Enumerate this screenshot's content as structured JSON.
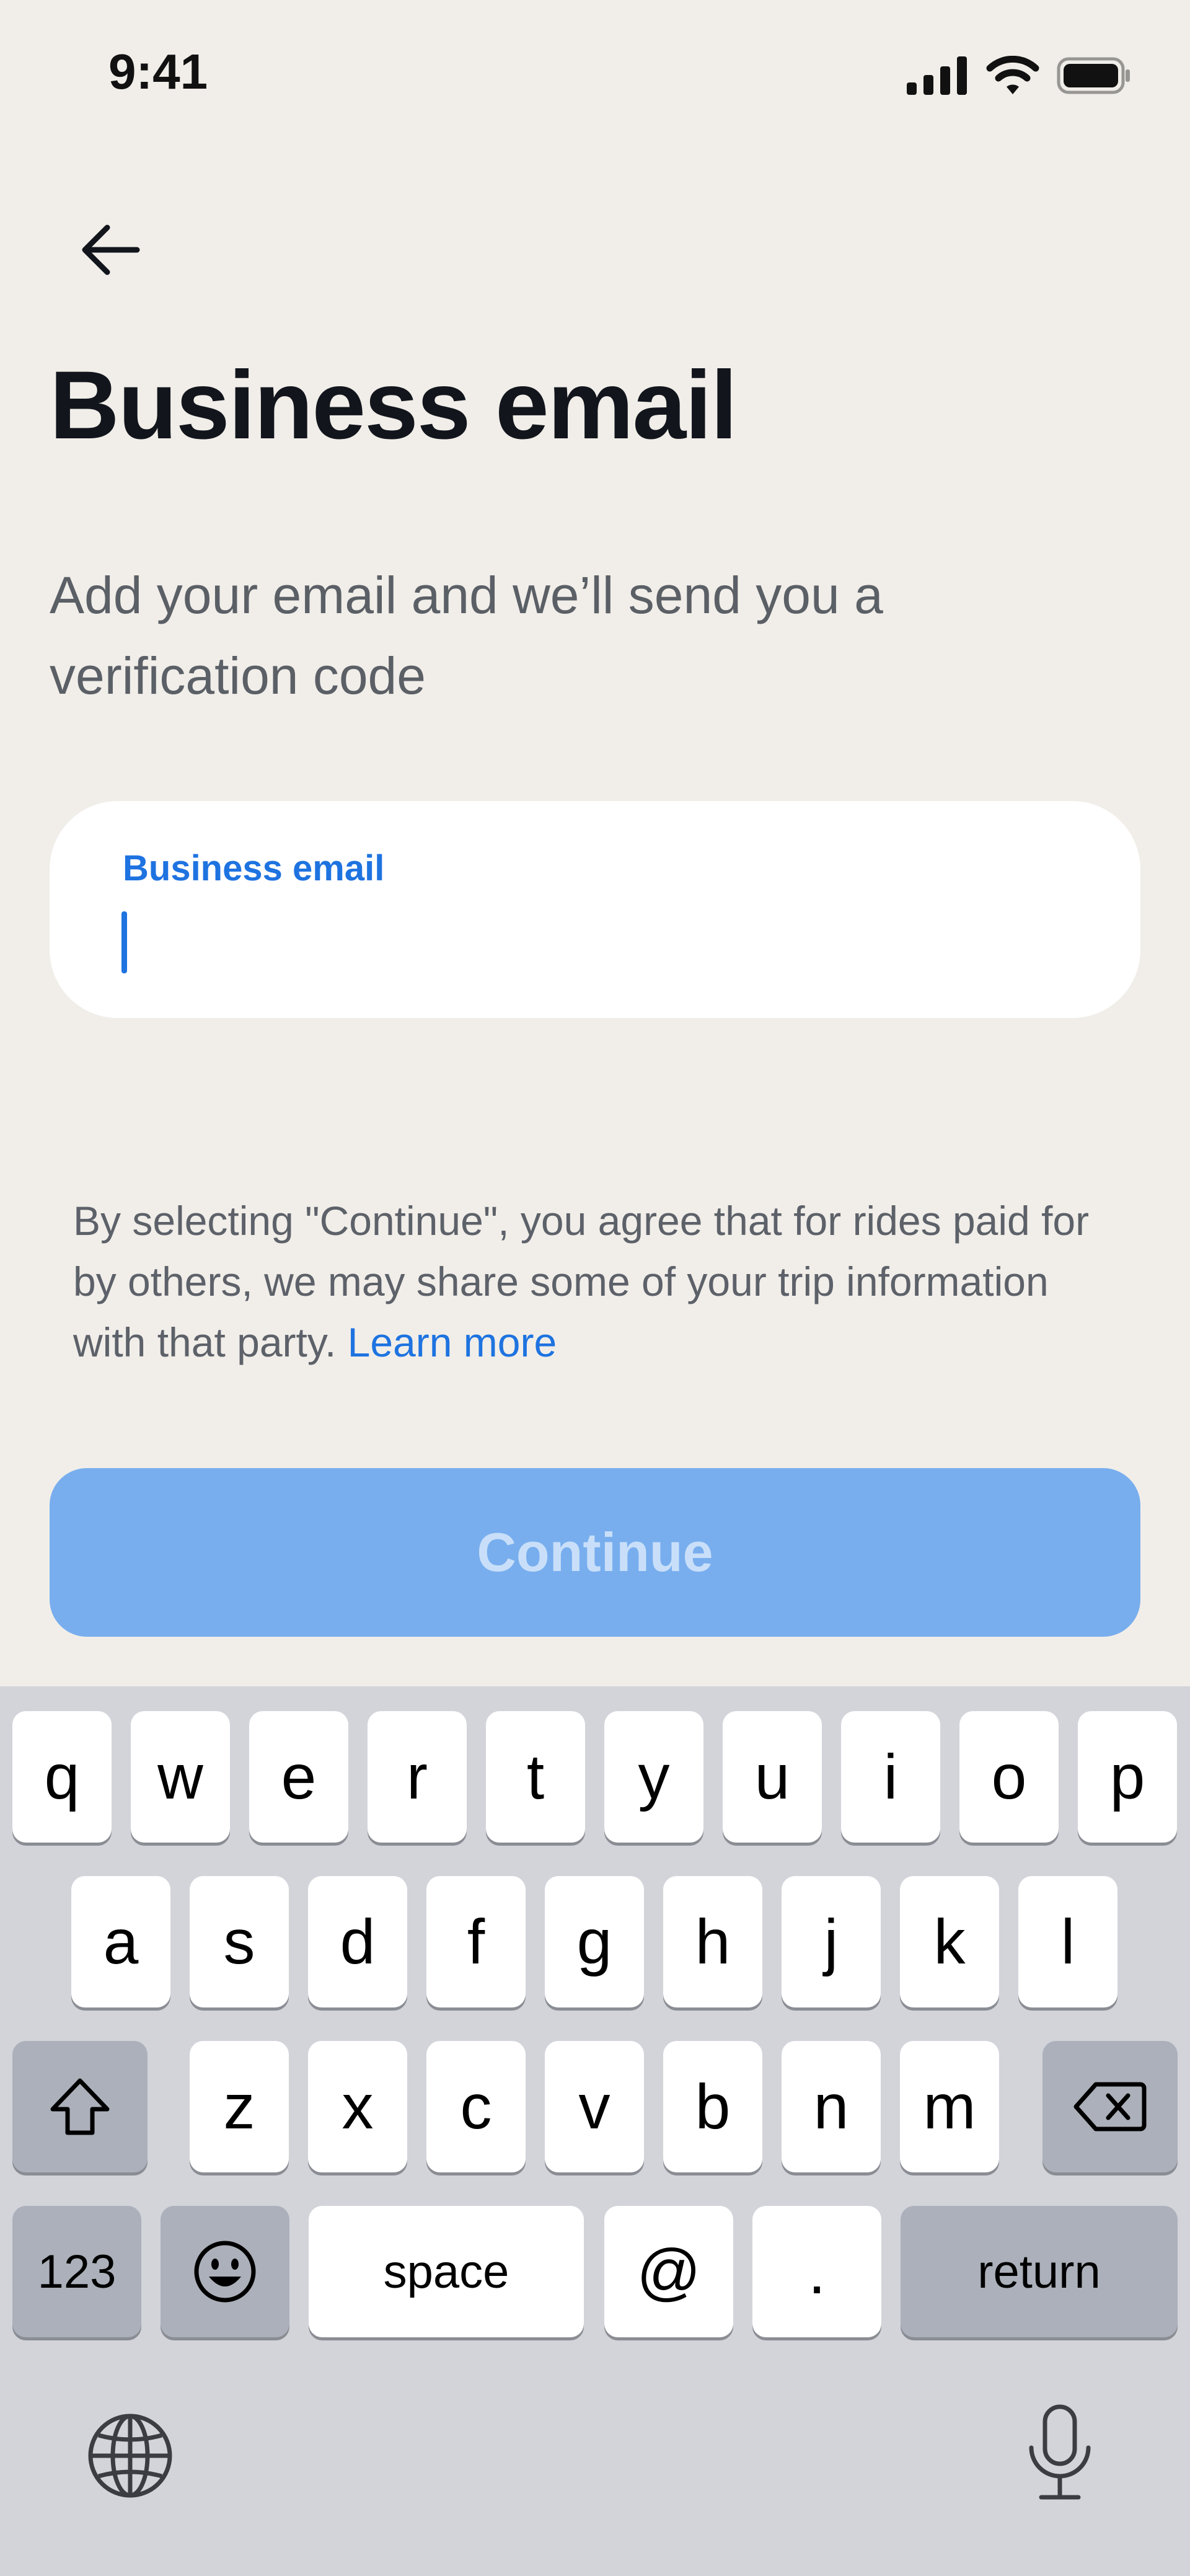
{
  "status_bar": {
    "time": "9:41",
    "icons": [
      "cellular-signal-icon",
      "wifi-icon",
      "battery-icon"
    ]
  },
  "nav": {
    "back_icon": "arrow-left-icon"
  },
  "title": "Business email",
  "subtitle": "Add your email and we’ll send you a verification code",
  "email_field": {
    "label": "Business email",
    "value": "",
    "placeholder": ""
  },
  "disclaimer": {
    "text": "By selecting \"Continue\", you agree that for rides paid for by others, we may share some of your trip information with that party.",
    "link": "Learn more"
  },
  "continue_button": {
    "label": "Continue",
    "enabled": false
  },
  "keyboard": {
    "row1": [
      "q",
      "w",
      "e",
      "r",
      "t",
      "y",
      "u",
      "i",
      "o",
      "p"
    ],
    "row2": [
      "a",
      "s",
      "d",
      "f",
      "g",
      "h",
      "j",
      "k",
      "l"
    ],
    "row3": [
      "z",
      "x",
      "c",
      "v",
      "b",
      "n",
      "m"
    ],
    "numbers_label": "123",
    "space_label": "space",
    "at_label": "@",
    "dot_label": ".",
    "return_label": "return",
    "icons": [
      "shift-icon",
      "backspace-icon",
      "emoji-icon",
      "globe-icon",
      "microphone-icon"
    ]
  },
  "colors": {
    "accent": "#1E73E0",
    "background": "#F1EEE9",
    "button_disabled": "#78AEEE",
    "title": "#12151C"
  }
}
